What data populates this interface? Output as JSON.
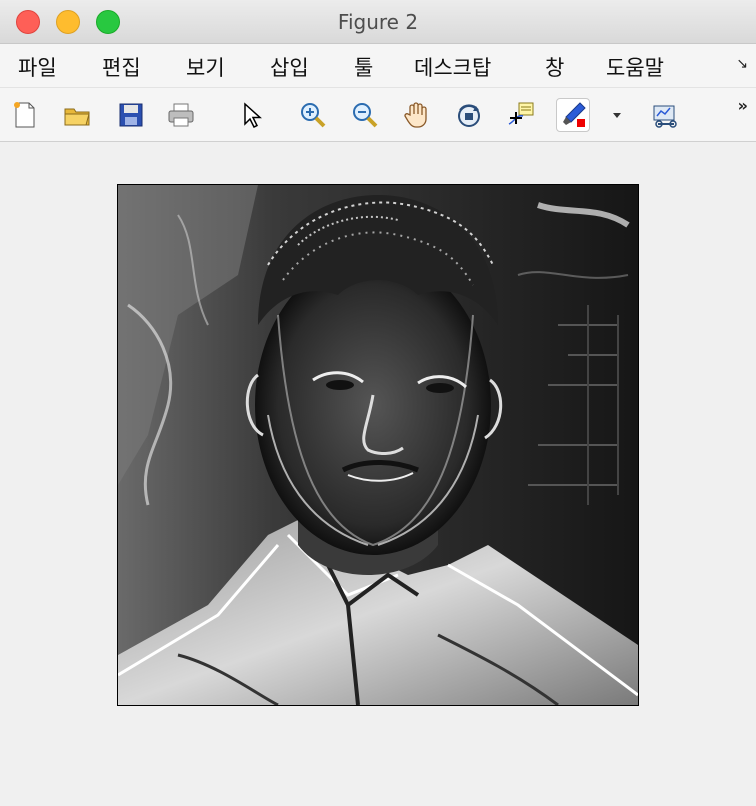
{
  "window": {
    "title": "Figure 2"
  },
  "menu": {
    "items": [
      "파일",
      "편집",
      "보기",
      "삽입",
      "툴",
      "데스크탑",
      "창",
      "도움말"
    ],
    "overflow": "↘"
  },
  "toolbar": {
    "buttons": [
      "new-figure-icon",
      "open-folder-icon",
      "save-disk-icon",
      "print-icon",
      "pointer-arrow-icon",
      "zoom-in-icon",
      "zoom-out-icon",
      "pan-hand-icon",
      "rotate-3d-icon",
      "data-cursor-icon",
      "brush-icon",
      "brush-dropdown-icon",
      "link-plot-icon"
    ],
    "overflow": "»"
  },
  "figure": {
    "content": "grayscale embossed portrait image"
  },
  "colors": {
    "window_bg": "#f0f0f0",
    "titlebar": "#dcdcdc",
    "close": "#fe5f57",
    "minimize": "#febc2e",
    "maximize": "#28c840"
  }
}
